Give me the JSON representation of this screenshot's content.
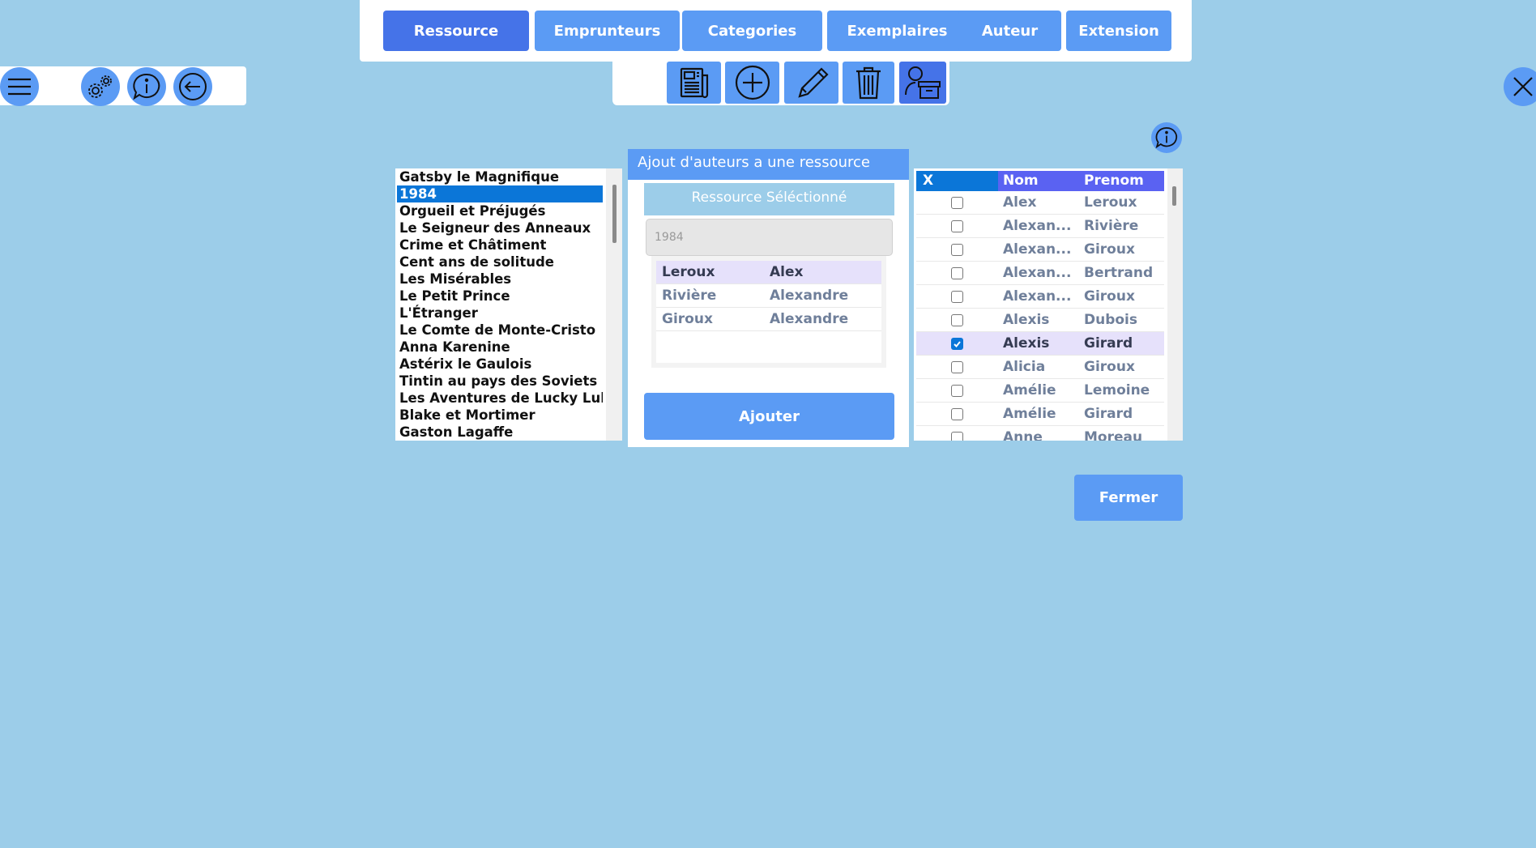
{
  "tabs": [
    {
      "label": "Ressource",
      "active": true
    },
    {
      "label": "Emprunteurs",
      "active": false
    },
    {
      "label": "Categories",
      "active": false
    },
    {
      "label": "Exemplaires",
      "active": false
    },
    {
      "label": "Auteur",
      "active": false
    },
    {
      "label": "Extension",
      "active": false
    }
  ],
  "toolbar": {
    "icons": [
      "newspaper-icon",
      "add-circle-icon",
      "pencil-icon",
      "trash-icon",
      "user-archive-icon"
    ]
  },
  "left_bar": {
    "icons": [
      "menu-icon",
      "settings-icon",
      "info-icon",
      "back-arrow-icon"
    ]
  },
  "resources": {
    "items": [
      "Gatsby le Magnifique",
      "1984",
      "Orgueil et Préjugés",
      "Le Seigneur des Anneaux",
      "Crime et Châtiment",
      "Cent ans de solitude",
      "Les Misérables",
      "Le Petit Prince",
      "L'Étranger",
      "Le Comte de Monte-Cristo",
      "Anna Karenine",
      "Astérix le Gaulois",
      "Tintin au pays des Soviets",
      "Les Aventures de Lucky Luke",
      "Blake et Mortimer",
      "Gaston Lagaffe"
    ],
    "selected_index": 1
  },
  "dialog": {
    "title": "Ajout d'auteurs a une ressource",
    "subtitle": "Ressource Séléctionné",
    "input_value": "1984",
    "authors": [
      {
        "nom": "Leroux",
        "prenom": "Alex",
        "highlight": true
      },
      {
        "nom": "Rivière",
        "prenom": "Alexandre",
        "highlight": false
      },
      {
        "nom": "Giroux",
        "prenom": "Alexandre",
        "highlight": false
      }
    ],
    "button_label": "Ajouter"
  },
  "grid": {
    "headers": {
      "x": "X",
      "nom": "Nom",
      "prenom": "Prenom"
    },
    "rows": [
      {
        "nom": "Alex",
        "prenom": "Leroux",
        "checked": false
      },
      {
        "nom": "Alexan...",
        "prenom": "Rivière",
        "checked": false
      },
      {
        "nom": "Alexan...",
        "prenom": "Giroux",
        "checked": false
      },
      {
        "nom": "Alexan...",
        "prenom": "Bertrand",
        "checked": false
      },
      {
        "nom": "Alexan...",
        "prenom": "Giroux",
        "checked": false
      },
      {
        "nom": "Alexis",
        "prenom": "Dubois",
        "checked": false
      },
      {
        "nom": "Alexis",
        "prenom": "Girard",
        "checked": true
      },
      {
        "nom": "Alicia",
        "prenom": "Giroux",
        "checked": false
      },
      {
        "nom": "Amélie",
        "prenom": "Lemoine",
        "checked": false
      },
      {
        "nom": "Amélie",
        "prenom": "Girard",
        "checked": false
      },
      {
        "nom": "Anne",
        "prenom": "Moreau",
        "checked": false
      }
    ]
  },
  "close_button_label": "Fermer",
  "colors": {
    "background": "#9ccde9",
    "accent": "#5b9bf4",
    "accent_active": "#4573e8",
    "selection": "#0b76d8",
    "header_purple": "#5a62f2",
    "row_highlight": "#e6e1fb"
  }
}
